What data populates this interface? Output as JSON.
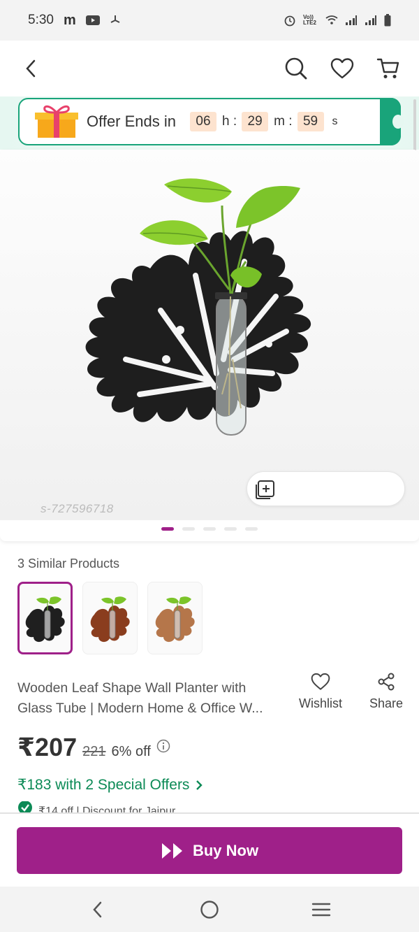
{
  "status_bar": {
    "time": "5:30",
    "carrier_text": "m",
    "network_label": "Vo)) LTE2"
  },
  "header": {
    "back_icon": "chevron-left-icon",
    "search_icon": "search-icon",
    "wishlist_icon": "heart-icon",
    "cart_icon": "cart-icon"
  },
  "offer": {
    "label": "Offer Ends in",
    "hours": "06",
    "hours_unit": "h :",
    "minutes": "29",
    "minutes_unit": "m :",
    "seconds": "59",
    "seconds_unit": "s",
    "icon": "gift-icon",
    "accent_color": "#19a47a"
  },
  "gallery": {
    "watermark": "s-727596718",
    "compare_icon": "add-to-compare-icon",
    "dots_count": 5,
    "active_dot": 1
  },
  "similar": {
    "title": "3 Similar Products",
    "selected_index": 0,
    "items": [
      {
        "color": "black"
      },
      {
        "color": "brown"
      },
      {
        "color": "light-brown"
      }
    ]
  },
  "product": {
    "title_line1": "Wooden Leaf Shape Wall Planter with",
    "title_line2": "Glass Tube | Modern Home & Office W...",
    "wishlist_label": "Wishlist",
    "share_label": "Share",
    "price": "₹207",
    "mrp": "221",
    "discount": "6% off",
    "special_offer": "₹183 with 2 Special Offers",
    "offer_line": "₹14 off | Discount for Jaipur"
  },
  "buy_button": {
    "label": "Buy Now",
    "color": "#9f2089"
  },
  "nav": {
    "back": "back-icon",
    "home": "home-icon",
    "menu": "recents-icon"
  }
}
